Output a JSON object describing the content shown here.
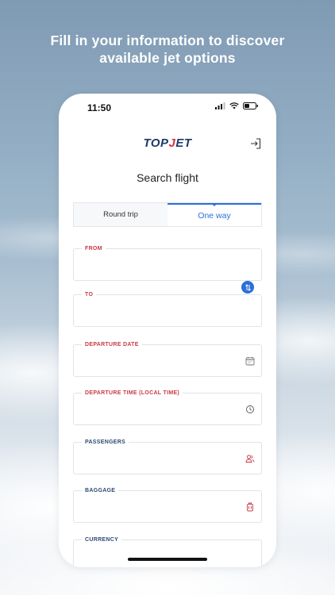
{
  "promo": {
    "line1": "Fill in your information to discover",
    "line2": "available jet options"
  },
  "status_bar": {
    "time": "11:50",
    "icons": [
      "signal-icon",
      "wifi-icon",
      "battery-icon"
    ]
  },
  "header": {
    "logo_part1": "TOP",
    "logo_part2": "J",
    "logo_part3": "ET",
    "login_icon": "login-icon"
  },
  "page_title": "Search flight",
  "tabs": [
    {
      "label": "Round trip",
      "active": false
    },
    {
      "label": "One way",
      "active": true
    }
  ],
  "form": {
    "from": {
      "label": "FROM",
      "value": ""
    },
    "to": {
      "label": "TO",
      "value": ""
    },
    "swap_icon": "swap-icon",
    "departure_date": {
      "label": "DEPARTURE DATE",
      "value": "",
      "icon": "calendar-icon"
    },
    "departure_time": {
      "label": "DEPARTURE TIME (LOCAL TIME)",
      "value": "",
      "icon": "clock-icon"
    },
    "passengers": {
      "label": "PASSENGERS",
      "value": "",
      "icon": "passengers-icon"
    },
    "baggage": {
      "label": "BAGGAGE",
      "value": "",
      "icon": "baggage-icon"
    },
    "currency": {
      "label": "CURRENCY",
      "value": ""
    }
  },
  "colors": {
    "accent_blue": "#2b6fd8",
    "label_red": "#c83a45",
    "label_navy": "#2e4a73",
    "logo_navy": "#1d3a6b",
    "logo_red": "#d3363c"
  }
}
